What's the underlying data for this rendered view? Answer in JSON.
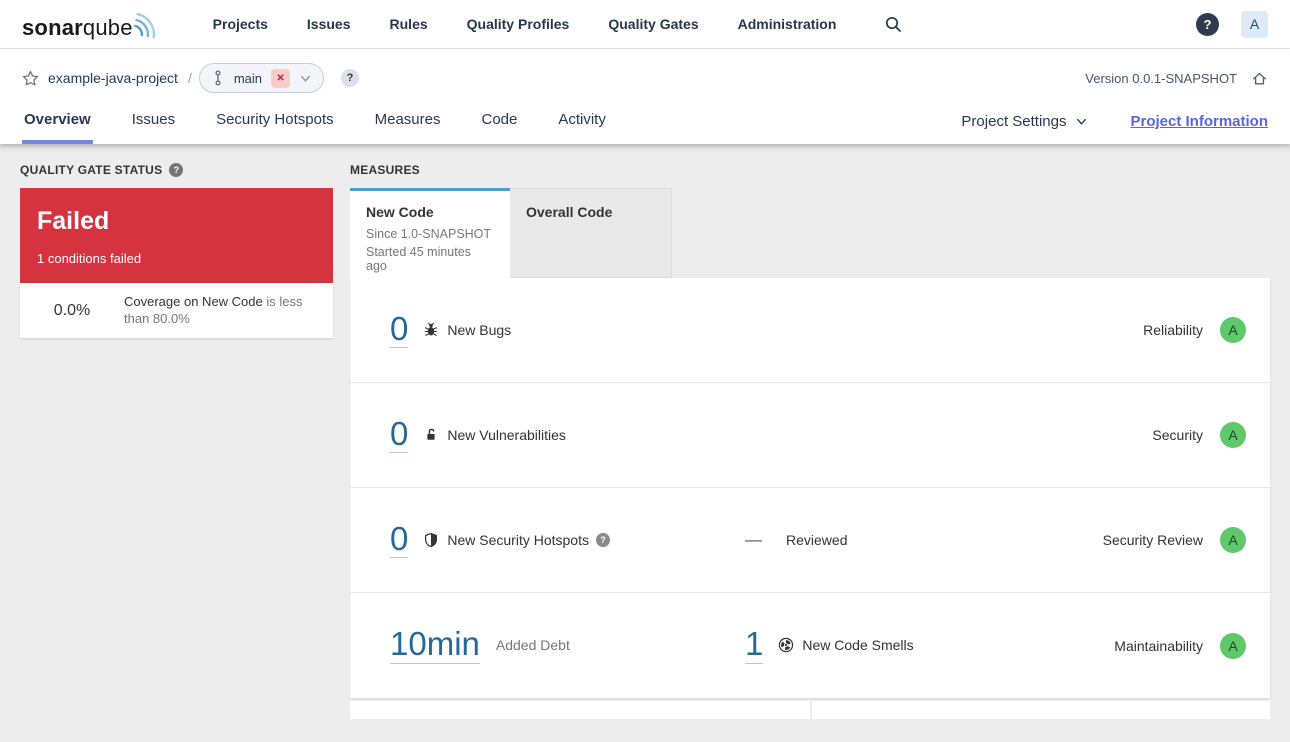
{
  "glyphs": {
    "question": "?",
    "close_x": "✕",
    "avatar_help": "?",
    "dash": "—"
  },
  "colors": {
    "link_blue": "#236a97",
    "tab_accent_blue": "#4b9fd5",
    "failed_red": "#d4333f",
    "rating_a_green": "#5ec86b",
    "active_tab_underline": "#7486de",
    "project_info_link": "#5867dd"
  },
  "topnav": {
    "logo_bold": "sonar",
    "logo_light": "qube",
    "items": [
      "Projects",
      "Issues",
      "Rules",
      "Quality Profiles",
      "Quality Gates",
      "Administration"
    ],
    "avatar_initial": "A"
  },
  "breadcrumb": {
    "project": "example-java-project",
    "separator": "/",
    "branch": "main",
    "version": "Version 0.0.1-SNAPSHOT"
  },
  "tabs": {
    "items": [
      "Overview",
      "Issues",
      "Security Hotspots",
      "Measures",
      "Code",
      "Activity"
    ],
    "active": "Overview",
    "settings_label": "Project Settings",
    "info_label": "Project Information"
  },
  "quality_gate": {
    "heading": "QUALITY GATE STATUS",
    "status": "Failed",
    "conditions_summary": "1 conditions failed",
    "condition_value": "0.0%",
    "condition_metric": "Coverage on New Code",
    "condition_comparison": "is less than 80.0%"
  },
  "measures": {
    "heading": "MEASURES",
    "new_code_tab": {
      "label": "New Code",
      "line1": "Since 1.0-SNAPSHOT",
      "line2": "Started 45 minutes ago"
    },
    "overall_code_tab": {
      "label": "Overall Code"
    },
    "rows": [
      {
        "value": "0",
        "label": "New Bugs",
        "domain": "Reliability",
        "rating": "A"
      },
      {
        "value": "0",
        "label": "New Vulnerabilities",
        "domain": "Security",
        "rating": "A"
      },
      {
        "value": "0",
        "label": "New Security Hotspots",
        "reviewed_value": "—",
        "reviewed_label": "Reviewed",
        "domain": "Security Review",
        "rating": "A"
      },
      {
        "value": "10min",
        "label": "Added Debt",
        "value2": "1",
        "label2": "New Code Smells",
        "domain": "Maintainability",
        "rating": "A"
      }
    ]
  }
}
